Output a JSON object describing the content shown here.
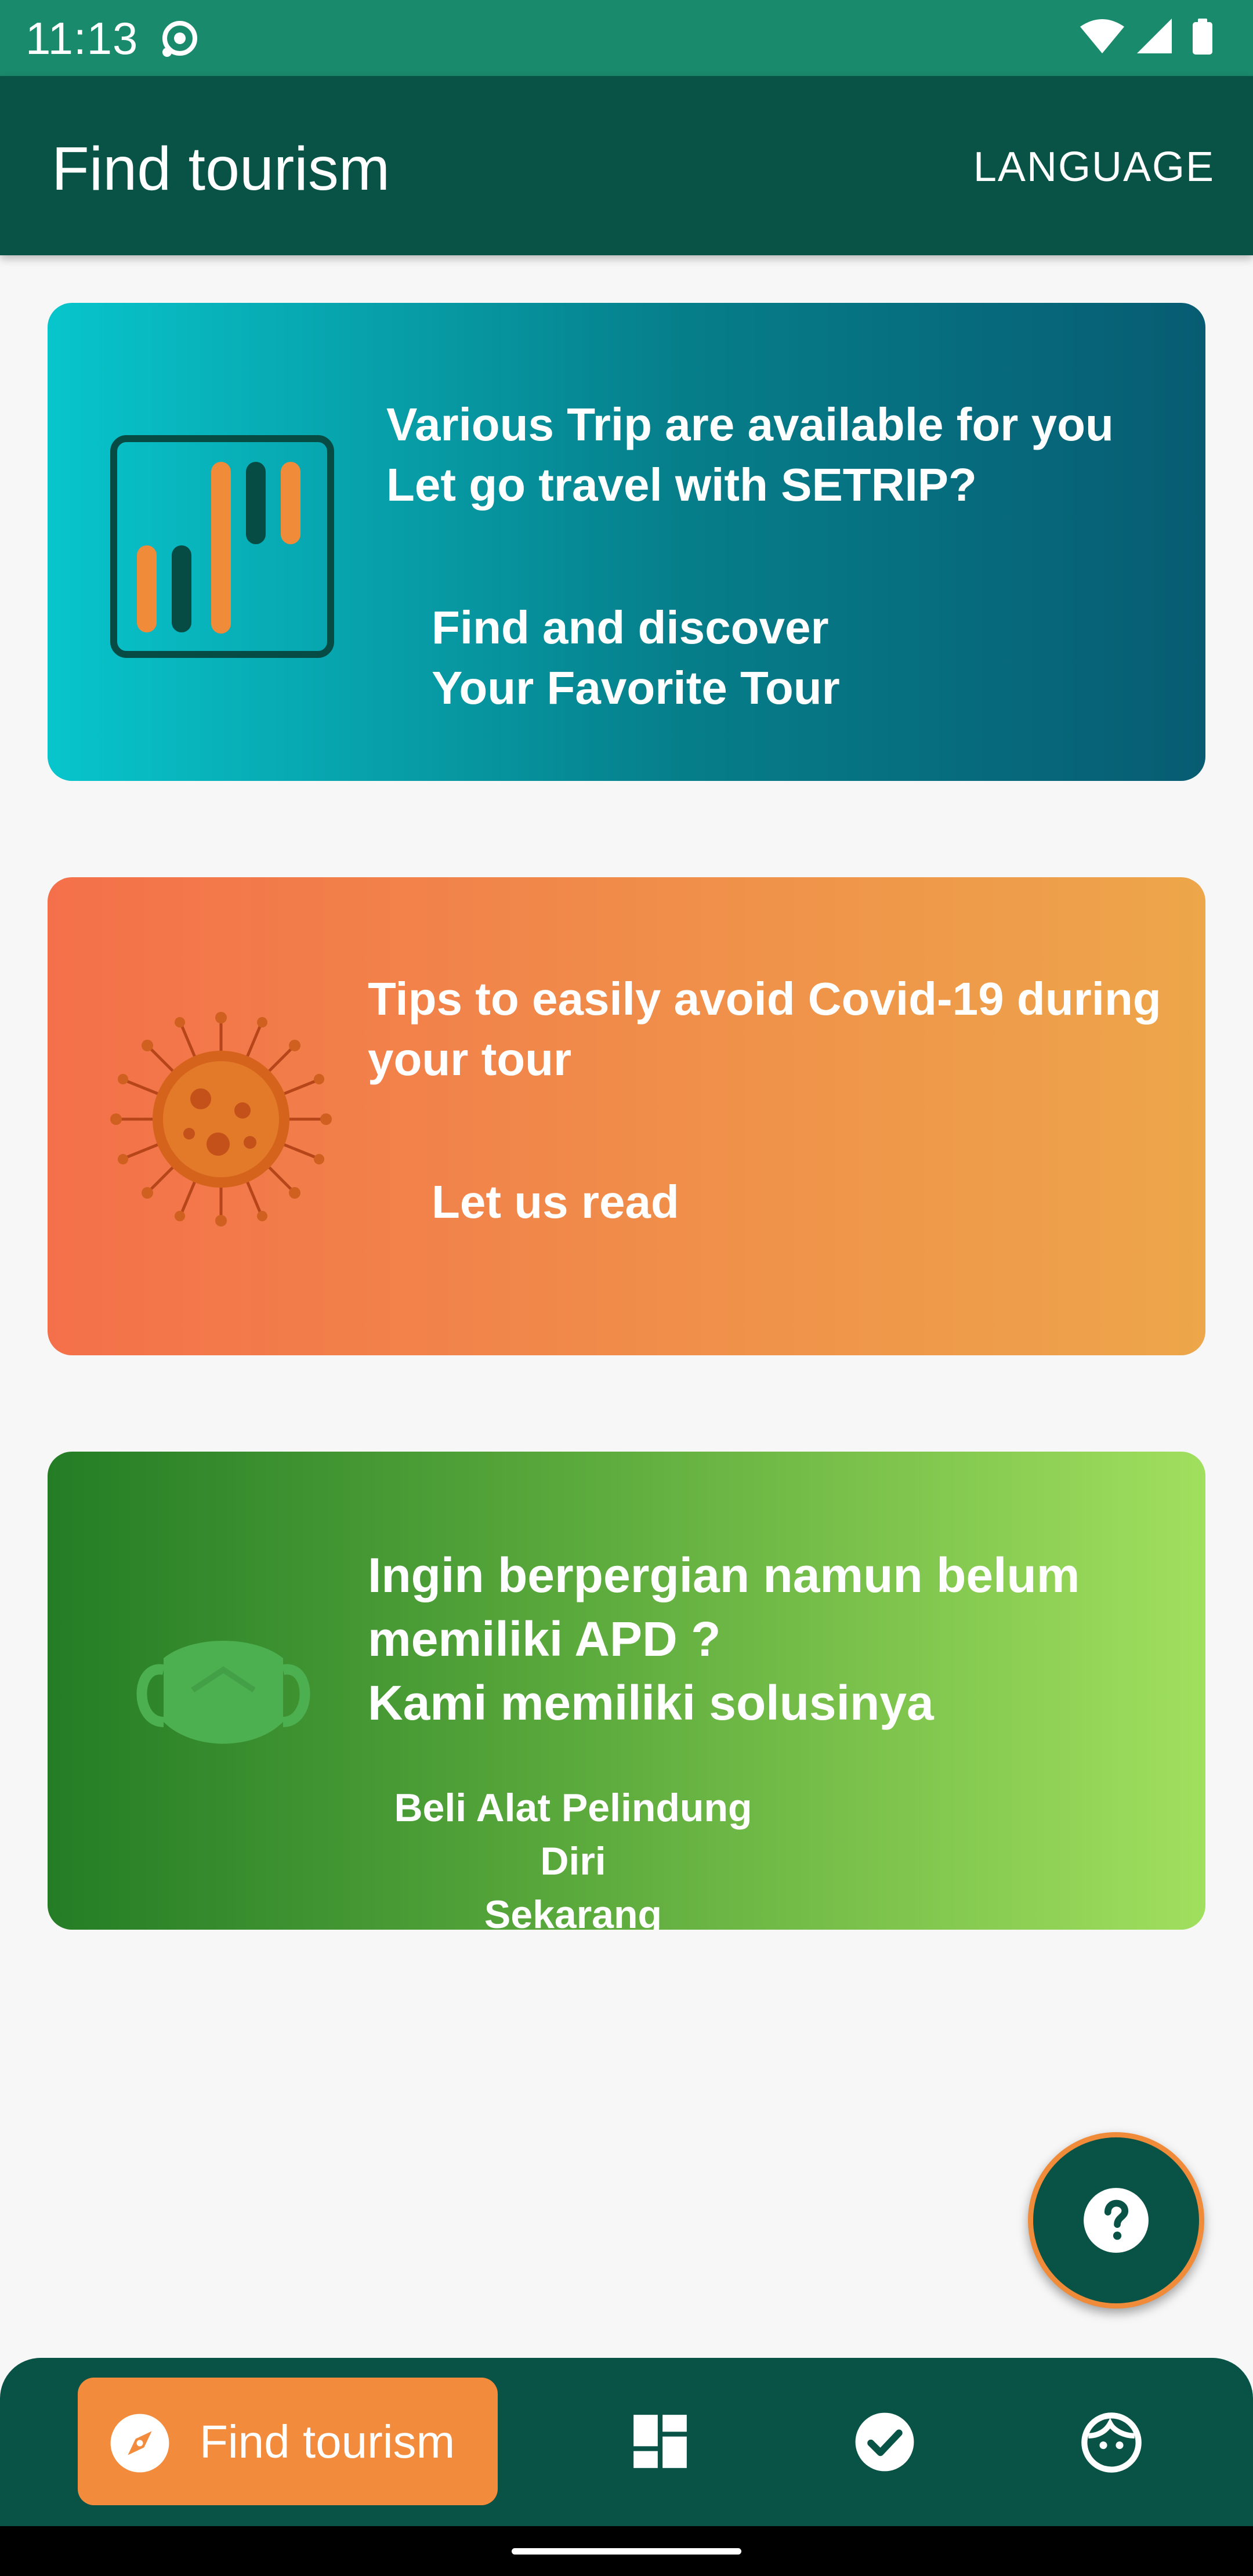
{
  "status_bar": {
    "time": "11:13",
    "icons": [
      "cast-icon",
      "wifi-icon",
      "signal-icon",
      "battery-icon"
    ]
  },
  "app_bar": {
    "title": "Find tourism",
    "language_label": "LANGUAGE"
  },
  "cards": [
    {
      "icon": "bar-chart-icon",
      "text": [
        "Various Trip are available for you",
        "Let go travel with SETRIP?"
      ],
      "link": [
        "Find and discover",
        "Your Favorite Tour"
      ]
    },
    {
      "icon": "virus-icon",
      "text": [
        "Tips to easily avoid Covid-19 during",
        "your tour"
      ],
      "link": [
        "Let us read"
      ]
    },
    {
      "icon": "face-mask-icon",
      "text": [
        "Ingin berpergian namun belum",
        "memiliki APD ?",
        "Kami memiliki solusinya"
      ],
      "link": [
        "Beli Alat Pelindung Diri",
        "Sekarang"
      ]
    }
  ],
  "fab": {
    "icon": "help-icon"
  },
  "bottom_nav": {
    "active_label": "Find tourism",
    "items": [
      "compass-icon",
      "dashboard-icon",
      "check-circle-icon",
      "face-icon"
    ]
  },
  "colors": {
    "status_bar": "#1a8a6c",
    "app_bar": "#085346",
    "accent_orange": "#f38b3c",
    "background": "#f7f7f7"
  }
}
